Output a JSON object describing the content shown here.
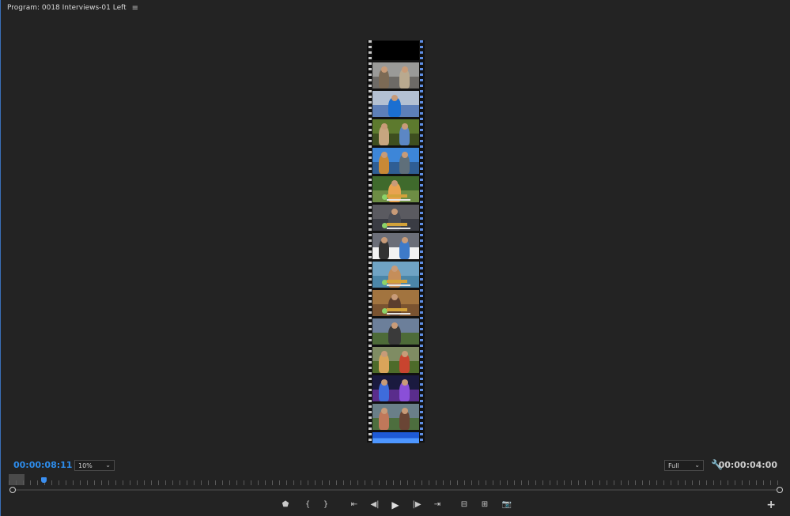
{
  "panel": {
    "title": "Program: 0018 Interviews-01 Left",
    "menu_icon": "hamburger-menu-icon"
  },
  "timecode": {
    "current": "00:00:08:11",
    "duration": "00:00:04:00"
  },
  "zoom": {
    "selected": "10%"
  },
  "resolution": {
    "selected": "Full"
  },
  "icons": {
    "settings": "wrench-icon",
    "add": "plus-icon"
  },
  "transport": [
    {
      "name": "add-marker-button",
      "icon": "marker-icon",
      "glyph": "⬟"
    },
    {
      "name": "mark-in-button",
      "icon": "mark-in-icon",
      "glyph": "{"
    },
    {
      "name": "mark-out-button",
      "icon": "mark-out-icon",
      "glyph": "}"
    },
    {
      "name": "go-to-in-button",
      "icon": "go-to-in-icon",
      "glyph": "⇤"
    },
    {
      "name": "step-back-button",
      "icon": "step-back-icon",
      "glyph": "◀|"
    },
    {
      "name": "play-button",
      "icon": "play-icon",
      "glyph": "▶"
    },
    {
      "name": "step-forward-button",
      "icon": "step-forward-icon",
      "glyph": "|▶"
    },
    {
      "name": "go-to-out-button",
      "icon": "go-to-out-icon",
      "glyph": "⇥"
    },
    {
      "name": "lift-button",
      "icon": "lift-icon",
      "glyph": "⊟"
    },
    {
      "name": "extract-button",
      "icon": "extract-icon",
      "glyph": "⊞"
    },
    {
      "name": "export-frame-button",
      "icon": "camera-icon",
      "glyph": "📷"
    }
  ],
  "colors": {
    "accent": "#2d8ceb",
    "background": "#232323"
  },
  "filmstrip": {
    "frames": [
      {
        "sky": "#000000",
        "ground": "#000000",
        "figs": []
      },
      {
        "sky": "#9a9a98",
        "ground": "#6d6a66",
        "figs": [
          "#7c6a55",
          "#b9a98f"
        ]
      },
      {
        "sky": "#b3c0d2",
        "ground": "#5d7fb8",
        "figs": [
          "#1b6fd1"
        ]
      },
      {
        "sky": "#5d7a2e",
        "ground": "#3e4f1f",
        "figs": [
          "#c7a680",
          "#5c87c4"
        ]
      },
      {
        "sky": "#3d86d8",
        "ground": "#2f5e94",
        "figs": [
          "#c98936",
          "#5f6f7a"
        ]
      },
      {
        "sky": "#3f6a2c",
        "ground": "#6d8d44",
        "figs": [
          "#e8a34f"
        ],
        "lower_third": true
      },
      {
        "sky": "#5a5a60",
        "ground": "#3a3c44",
        "figs": [
          "#4a4c54"
        ],
        "lower_third": true
      },
      {
        "sky": "#6b6e78",
        "ground": "#f2f2f2",
        "figs": [
          "#333333",
          "#3e7ac8"
        ]
      },
      {
        "sky": "#6fa3c4",
        "ground": "#4b86a8",
        "figs": [
          "#c58e5a"
        ],
        "lower_third": true
      },
      {
        "sky": "#a2743f",
        "ground": "#7a5330",
        "figs": [
          "#5b3e2e"
        ],
        "lower_third": true
      },
      {
        "sky": "#6c7f9a",
        "ground": "#4d6b38",
        "figs": [
          "#3a3a3a"
        ]
      },
      {
        "sky": "#7f8c63",
        "ground": "#4d6b2a",
        "figs": [
          "#d9a45a",
          "#c8442f"
        ]
      },
      {
        "sky": "#1a1a3f",
        "ground": "#5a2d8c",
        "figs": [
          "#3e6cdb",
          "#8a4fd8"
        ]
      },
      {
        "sky": "#6a7f88",
        "ground": "#4d6e3e",
        "figs": [
          "#c0785a",
          "#6a4535"
        ]
      },
      {
        "sky": "#1e5ad6",
        "ground": "#4d96ff",
        "figs": []
      }
    ]
  }
}
